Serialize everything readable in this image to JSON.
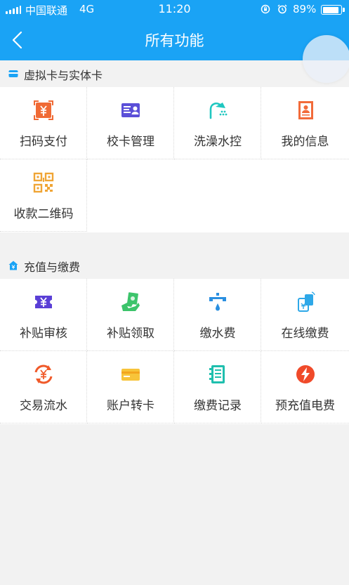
{
  "status_bar": {
    "carrier": "中国联通",
    "network": "4G",
    "time": "11:20",
    "battery": "89%"
  },
  "header": {
    "title": "所有功能"
  },
  "sections": [
    {
      "title": "虚拟卡与实体卡",
      "items": [
        {
          "label": "扫码支付",
          "icon": "scan-pay-icon"
        },
        {
          "label": "校卡管理",
          "icon": "card-manage-icon"
        },
        {
          "label": "洗澡水控",
          "icon": "shower-icon"
        },
        {
          "label": "我的信息",
          "icon": "my-info-icon"
        },
        {
          "label": "收款二维码",
          "icon": "qr-code-icon"
        }
      ]
    },
    {
      "title": "充值与缴费",
      "items": [
        {
          "label": "补贴审核",
          "icon": "subsidy-review-icon"
        },
        {
          "label": "补贴领取",
          "icon": "subsidy-claim-icon"
        },
        {
          "label": "缴水费",
          "icon": "water-tap-icon"
        },
        {
          "label": "在线缴费",
          "icon": "online-pay-icon"
        },
        {
          "label": "交易流水",
          "icon": "transaction-icon"
        },
        {
          "label": "账户转卡",
          "icon": "account-transfer-icon"
        },
        {
          "label": "缴费记录",
          "icon": "payment-record-icon"
        },
        {
          "label": "预充值电费",
          "icon": "electricity-icon"
        }
      ]
    }
  ],
  "colors": {
    "header_bg": "#1aa3f5",
    "page_bg": "#f2f2f2"
  }
}
